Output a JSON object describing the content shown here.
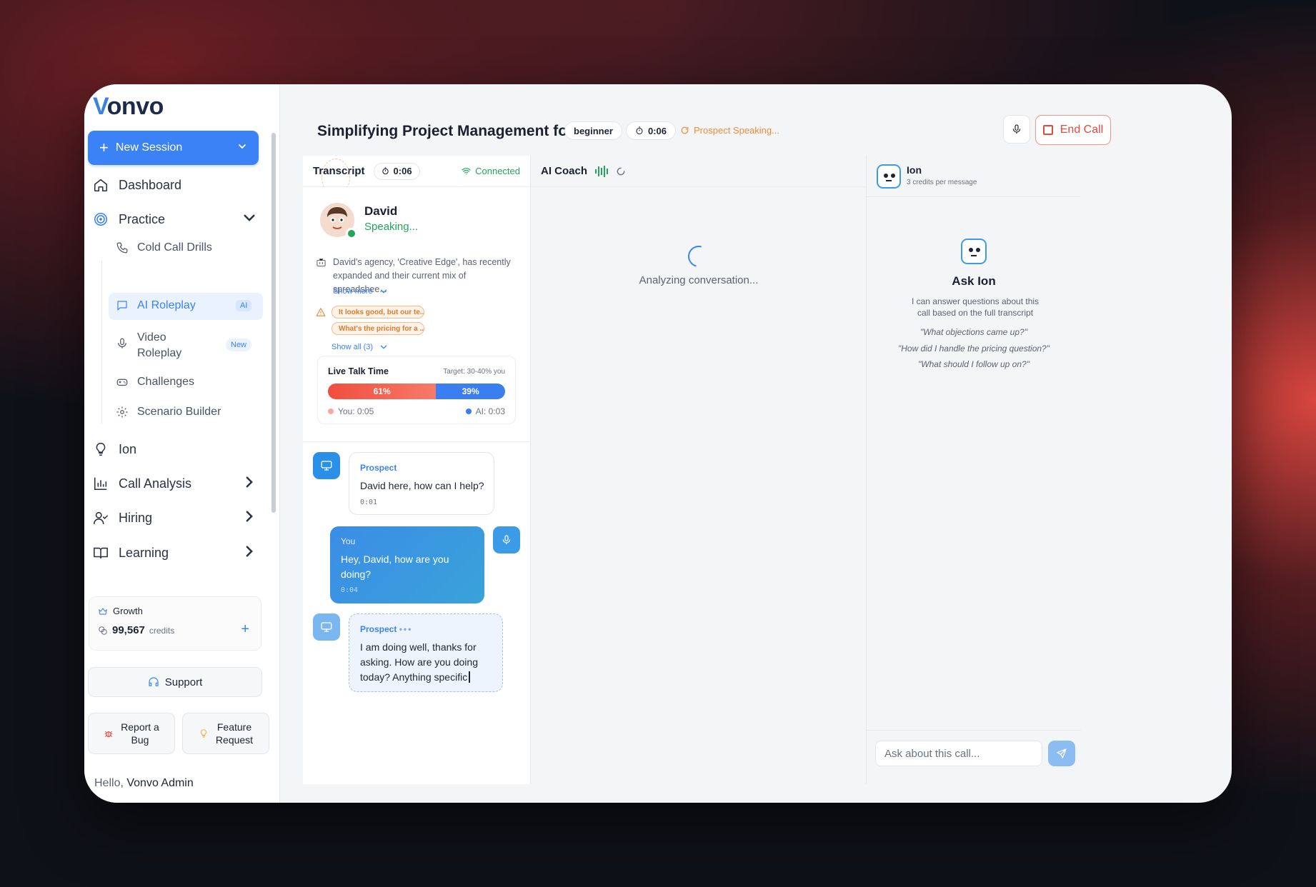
{
  "app": {
    "logo_v": "V",
    "logo_rest": "onvo"
  },
  "sidebar": {
    "new_session": "New Session",
    "nav": {
      "dashboard": "Dashboard",
      "practice": "Practice",
      "ion": "Ion",
      "call_analysis": "Call Analysis",
      "hiring": "Hiring",
      "learning": "Learning"
    },
    "practice_items": {
      "cold_call": "Cold Call Drills",
      "ai_roleplay": "AI Roleplay",
      "ai_badge": "AI",
      "video_roleplay_1": "Video",
      "video_roleplay_2": "Roleplay",
      "new_badge": "New",
      "challenges": "Challenges",
      "scenario": "Scenario Builder"
    },
    "plan": {
      "name": "Growth",
      "credits": "99,567",
      "credits_label": "credits"
    },
    "support": "Support",
    "report_bug_1": "Report a",
    "report_bug_2": "Bug",
    "feature_req_1": "Feature",
    "feature_req_2": "Request",
    "hello": "Hello,",
    "user": "Vonvo Admin"
  },
  "header": {
    "title": "Simplifying Project Management for David",
    "level": "beginner",
    "timer": "0:06",
    "status": "Prospect Speaking...",
    "end_call": "End Call"
  },
  "transcript": {
    "title": "Transcript",
    "timer": "0:06",
    "connection": "Connected",
    "prospect": {
      "name": "David",
      "status": "Speaking...",
      "desc_1": "David's agency, 'Creative Edge', has recently",
      "desc_2": "expanded and their current mix of spreadshee...",
      "show_more": "Show more",
      "objections": [
        "It looks good, but our te...",
        "What's the pricing for a ..."
      ],
      "show_all": "Show all (3)"
    },
    "talk_time": {
      "title": "Live Talk Time",
      "target": "Target: 30-40% you",
      "you_pct": "61%",
      "ai_pct": "39%",
      "you_fraction": 0.61,
      "you_label": "You: 0:05",
      "ai_label": "AI: 0:03"
    },
    "messages": [
      {
        "sender": "Prospect",
        "line1": "David here, how can I help?",
        "line2": "",
        "line3": "",
        "time": "0:01"
      },
      {
        "sender": "You",
        "line1": "Hey, David, how are you",
        "line2": "doing?",
        "line3": "",
        "time": "0:04"
      },
      {
        "sender": "Prospect",
        "line1": "I am doing well, thanks for",
        "line2": "asking. How are you doing",
        "line3": "today? Anything specific",
        "time": ""
      }
    ]
  },
  "coach": {
    "title": "AI Coach",
    "analyzing": "Analyzing conversation..."
  },
  "ion": {
    "title": "Ion",
    "subtitle": "3 credits per message",
    "ask_title": "Ask Ion",
    "desc_1": "I can answer questions about this",
    "desc_2": "call based on the full transcript",
    "suggestions": [
      "\"What objections came up?\"",
      "\"How did I handle the pricing question?\"",
      "\"What should I follow up on?\""
    ],
    "input_placeholder": "Ask about this call..."
  },
  "colors": {
    "accent": "#3b82f6",
    "success": "#22a55a",
    "danger": "#e5483d",
    "warning": "#f08a3a"
  }
}
